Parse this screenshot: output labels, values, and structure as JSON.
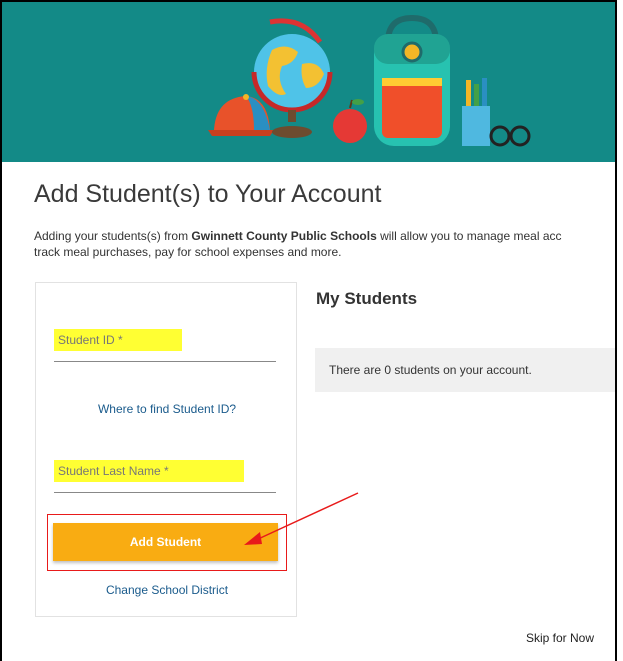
{
  "page": {
    "title": "Add Student(s) to Your Account",
    "intro_line1_prefix": "Adding your students(s) from ",
    "intro_district": "Gwinnett County Public Schools",
    "intro_line1_suffix": " will allow you to manage meal acc",
    "intro_line2": "track meal purchases, pay for school expenses and more."
  },
  "form": {
    "student_id_placeholder": "Student ID *",
    "where_to_find_link": "Where to find Student ID?",
    "last_name_placeholder": "Student Last Name *",
    "add_button": "Add Student",
    "change_district_link": "Change School District"
  },
  "my_students": {
    "heading": "My Students",
    "empty_message": "There are 0 students on your account."
  },
  "footer": {
    "skip_link": "Skip for Now"
  },
  "colors": {
    "banner": "#138a87",
    "button": "#f9ac12",
    "highlight": "#ffff33",
    "annotation": "#e81a1a",
    "link": "#1a5b8c"
  },
  "icons": [
    "globe-icon",
    "backpack-icon",
    "cap-icon",
    "apple-icon",
    "pencil-cup-icon",
    "glasses-icon"
  ]
}
